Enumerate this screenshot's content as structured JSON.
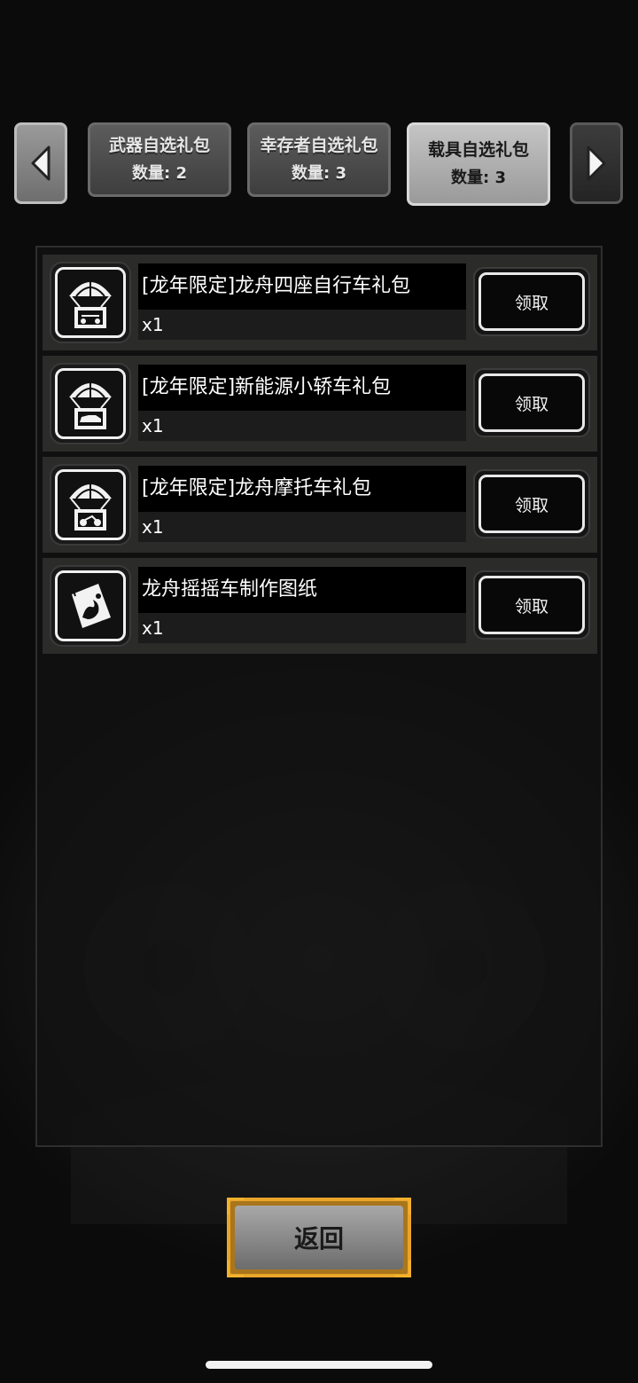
{
  "tabs": [
    {
      "title": "武器自选礼包",
      "count": "数量: 2",
      "active": false
    },
    {
      "title": "幸存者自选礼包",
      "count": "数量: 3",
      "active": false
    },
    {
      "title": "载具自选礼包",
      "count": "数量: 3",
      "active": true
    }
  ],
  "items": [
    {
      "name": "[龙年限定]龙舟四座自行车礼包",
      "qty": "x1",
      "icon": "parachute-crate-bike-icon",
      "action": "领取"
    },
    {
      "name": "[龙年限定]新能源小轿车礼包",
      "qty": "x1",
      "icon": "parachute-crate-car-icon",
      "action": "领取"
    },
    {
      "name": "[龙年限定]龙舟摩托车礼包",
      "qty": "x1",
      "icon": "parachute-crate-motorcycle-icon",
      "action": "领取"
    },
    {
      "name": "龙舟摇摇车制作图纸",
      "qty": "x1",
      "icon": "blueprint-scroll-icon",
      "action": "领取"
    }
  ],
  "return_label": "返回",
  "colors": {
    "accent_gold": "#e9a52a",
    "panel_row": "#2b2b2a"
  }
}
